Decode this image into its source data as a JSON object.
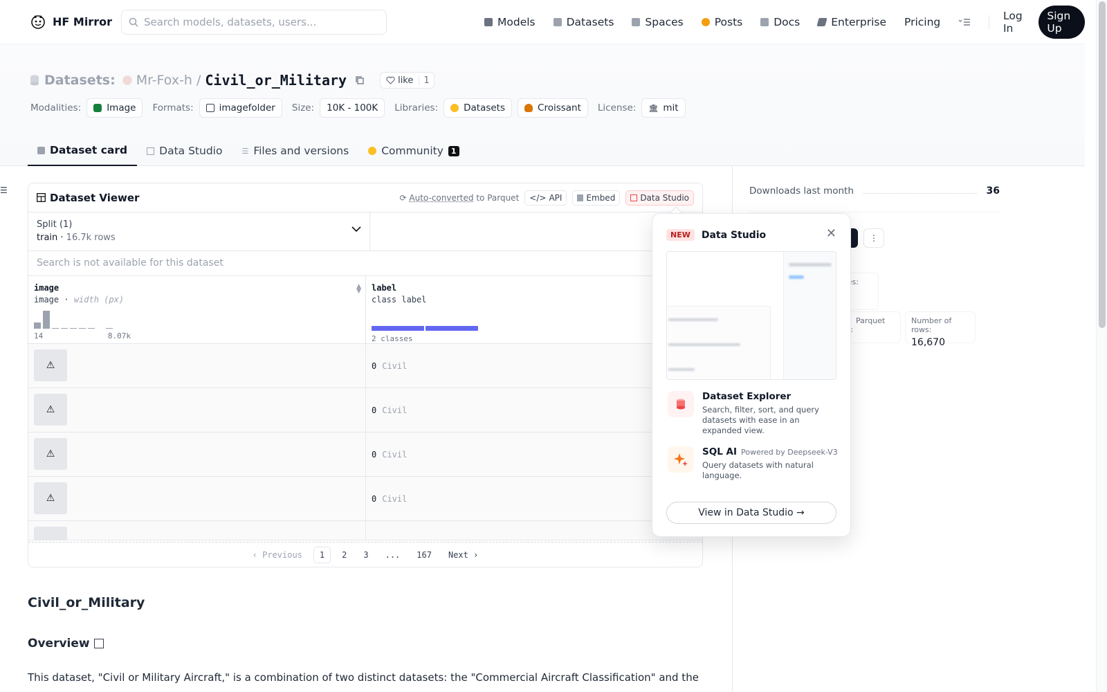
{
  "nav": {
    "brand": "HF Mirror",
    "search_placeholder": "Search models, datasets, users...",
    "links": [
      {
        "label": "Models",
        "icon": "cube-icon",
        "color": "#6b7280"
      },
      {
        "label": "Datasets",
        "icon": "database-icon",
        "color": "#9ca3af"
      },
      {
        "label": "Spaces",
        "icon": "grid-icon",
        "color": "#9ca3af"
      },
      {
        "label": "Posts",
        "icon": "chat-bubble-icon",
        "color": "#f59e0b"
      },
      {
        "label": "Docs",
        "icon": "book-icon",
        "color": "#9ca3af"
      },
      {
        "label": "Enterprise",
        "icon": "enterprise-icon",
        "color": "#6b7280"
      },
      {
        "label": "Pricing",
        "icon": "",
        "color": ""
      }
    ],
    "login": "Log In",
    "signup": "Sign Up"
  },
  "header": {
    "section": "Datasets:",
    "owner": "Mr-Fox-h",
    "separator": "/",
    "repo": "Civil_or_Military",
    "like_label": "like",
    "like_count": "1",
    "tags": {
      "modalities_label": "Modalities:",
      "modalities": "Image",
      "formats_label": "Formats:",
      "formats": "imagefolder",
      "size_label": "Size:",
      "size": "10K - 100K",
      "libraries_label": "Libraries:",
      "libraries": [
        "Datasets",
        "Croissant"
      ],
      "license_label": "License:",
      "license": "mit"
    }
  },
  "tabs": [
    {
      "label": "Dataset card",
      "active": true
    },
    {
      "label": "Data Studio",
      "active": false
    },
    {
      "label": "Files and versions",
      "active": false
    },
    {
      "label": "Community",
      "active": false,
      "count": "1"
    }
  ],
  "viewer": {
    "title": "Dataset Viewer",
    "auto_converted": "Auto-converted",
    "to_parquet": "to Parquet",
    "api": "API",
    "embed": "Embed",
    "data_studio": "Data Studio",
    "split_label": "Split (1)",
    "split_name": "train",
    "split_rows": "16.7k rows",
    "search_note": "Search is not available for this dataset",
    "columns": [
      {
        "name": "image",
        "type": "image",
        "subtype": "width (px)",
        "min": "14",
        "max": "8.07k",
        "hist": [
          0.35,
          1.0,
          0.05,
          0.05,
          0.05,
          0.05,
          0.05,
          0,
          0.05
        ]
      },
      {
        "name": "label",
        "type": "class label",
        "classes": "2 classes"
      }
    ],
    "rows": [
      {
        "image_icon": "⚠",
        "label_id": "0",
        "label_name": "Civil"
      },
      {
        "image_icon": "⚠",
        "label_id": "0",
        "label_name": "Civil"
      },
      {
        "image_icon": "⚠",
        "label_id": "0",
        "label_name": "Civil"
      },
      {
        "image_icon": "⚠",
        "label_id": "0",
        "label_name": "Civil"
      }
    ],
    "pager": {
      "prev": "Previous",
      "pages": [
        "1",
        "2",
        "3",
        "...",
        "167"
      ],
      "next": "Next"
    }
  },
  "card": {
    "h2": "Civil_or_Military",
    "h3": "Overview",
    "p": "This dataset, \"Civil or Military Aircraft,\" is a combination of two distinct datasets: the \"Commercial Aircraft Classification\" and the"
  },
  "sidebar": {
    "downloads_label": "Downloads last month",
    "downloads": "36",
    "stat1_label": "t files:",
    "stat2_label": "Parquet files:",
    "stat3_label": "Number of rows:",
    "stat3_value": "16,670"
  },
  "popover": {
    "badge": "NEW",
    "title": "Data Studio",
    "features": [
      {
        "title": "Dataset Explorer",
        "note": "",
        "desc": "Search, filter, sort, and query datasets with ease in an expanded view."
      },
      {
        "title": "SQL AI",
        "note": "Powered by Deepseek-V3",
        "desc": "Query datasets with natural language."
      }
    ],
    "cta": "View in Data Studio →"
  }
}
